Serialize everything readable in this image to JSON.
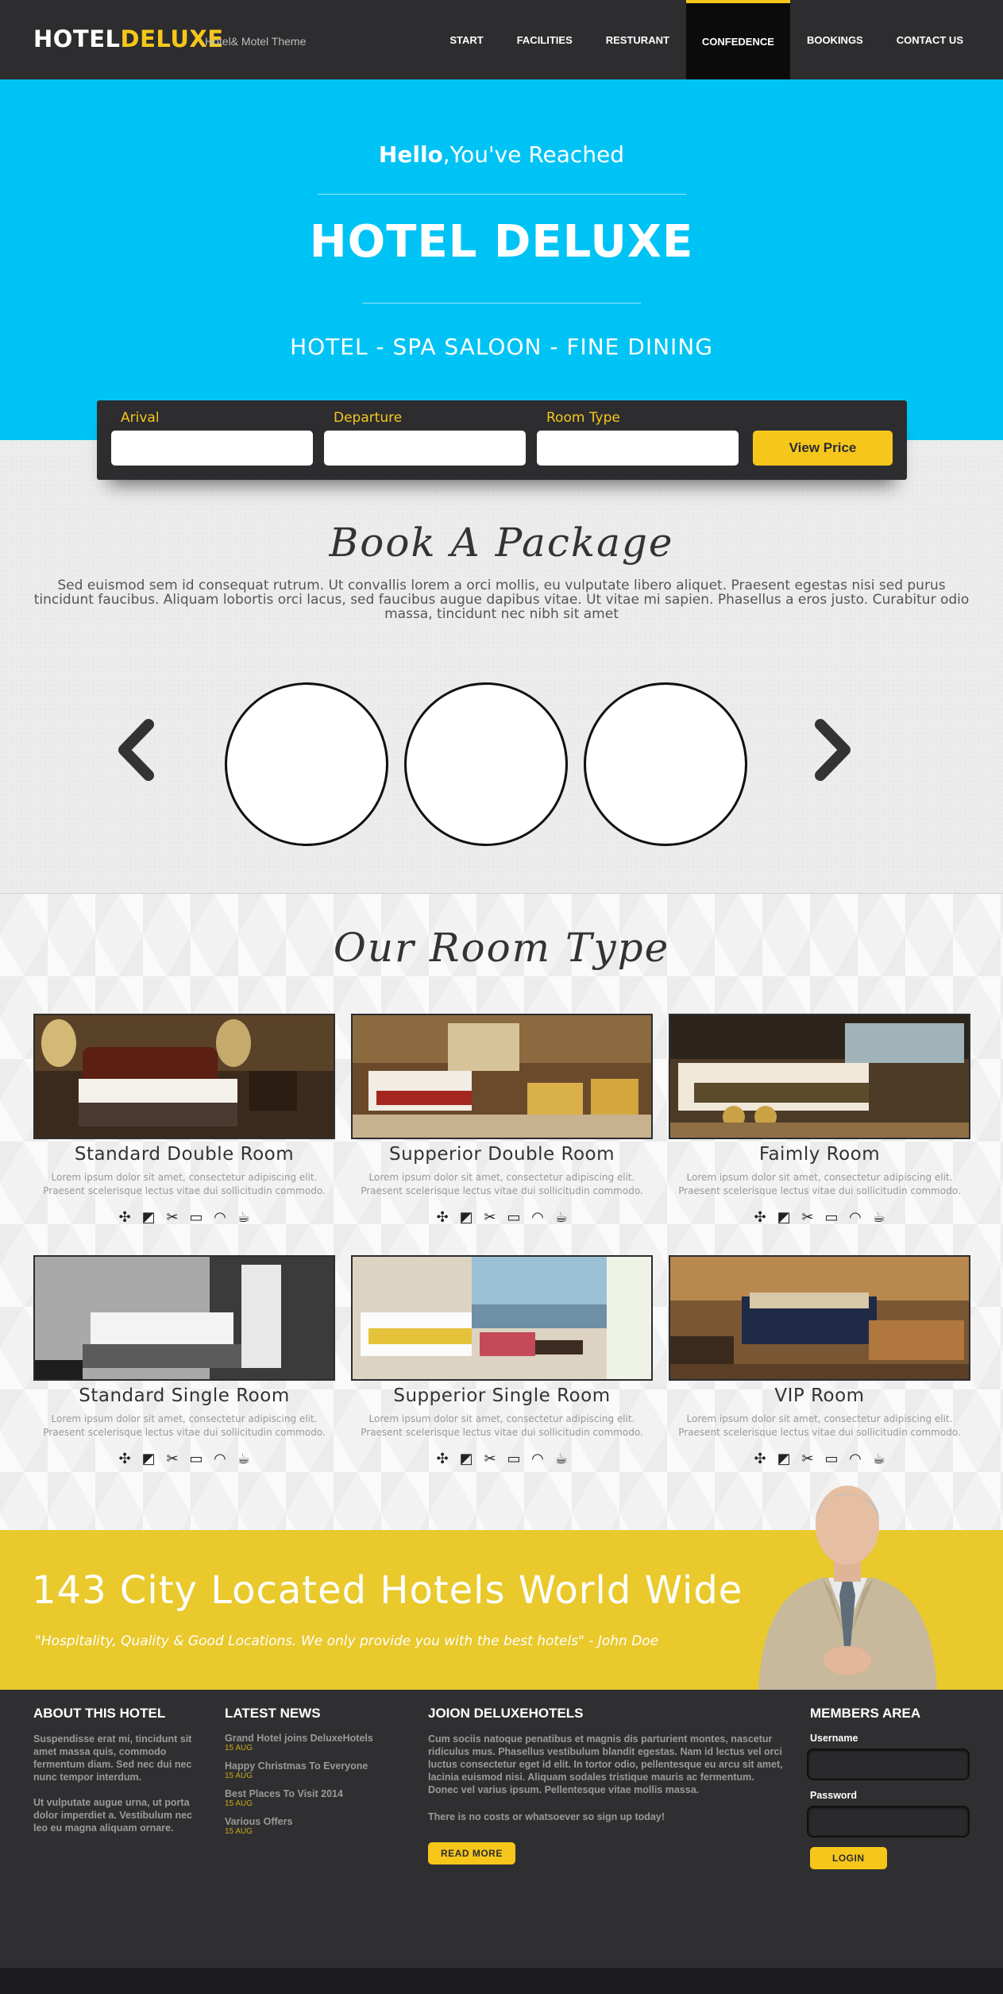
{
  "header": {
    "logo_part1": "HOTEL",
    "logo_part2": "DELUXE",
    "tagline": "Hotel& Motel Theme",
    "nav": [
      "START",
      "FACILITIES",
      "RESTURANT",
      "CONFEDENCE",
      "BOOKINGS",
      "CONTACT US"
    ],
    "active_nav": "CONFEDENCE"
  },
  "hero": {
    "hello_bold": "Hello",
    "hello_rest": ",You've Reached",
    "title": "HOTEL DELUXE",
    "subtitle": "HOTEL - SPA SALOON - FINE DINING"
  },
  "booking": {
    "arrival_label": "Arival",
    "departure_label": "Departure",
    "room_type_label": "Room Type",
    "view_price_label": "View Price"
  },
  "package": {
    "title": "Book A Package",
    "text": "Sed euismod sem id consequat rutrum. Ut convallis lorem a orci mollis, eu vulputate libero aliquet. Praesent egestas nisi sed purus tincidunt faucibus. Aliquam lobortis orci lacus, sed faucibus augue dapibus vitae. Ut vitae mi sapien. Phasellus a eros justo. Curabitur odio massa, tincidunt nec nibh sit amet"
  },
  "rooms": {
    "title": "Our Room Type",
    "desc": "Lorem ipsum dolor sit amet, consectetur adipiscing elit. Praesent scelerisque lectus vitae dui sollicitudin commodo.",
    "items": [
      {
        "name": "Standard Double Room"
      },
      {
        "name": "Supperior Double Room"
      },
      {
        "name": "Faimly Room"
      },
      {
        "name": "Standard Single Room"
      },
      {
        "name": "Supperior Single Room"
      },
      {
        "name": "VIP Room"
      }
    ],
    "amenity_icons": [
      "fan-icon",
      "hair-dryer-icon",
      "iron-icon",
      "tv-icon",
      "wifi-icon",
      "coffee-icon"
    ]
  },
  "banner": {
    "title": "143 City Located Hotels World Wide",
    "quote": "\"Hospitality, Quality & Good Locations. We only provide you with the best hotels\" - John Doe"
  },
  "footer": {
    "about": {
      "heading": "ABOUT THIS HOTEL",
      "p1": "Suspendisse erat mi, tincidunt sit amet massa quis, commodo fermentum diam. Sed nec dui nec nunc tempor interdum.",
      "p2": "Ut vulputate augue urna, ut porta dolor imperdiet a. Vestibulum nec leo eu magna aliquam ornare."
    },
    "news": {
      "heading": "LATEST NEWS",
      "items": [
        {
          "title": "Grand Hotel joins DeluxeHotels",
          "date": "15 AUG"
        },
        {
          "title": "Happy Christmas To Everyone",
          "date": "15 AUG"
        },
        {
          "title": "Best Places To Visit 2014",
          "date": "15 AUG"
        },
        {
          "title": "Various Offers",
          "date": "15 AUG"
        }
      ]
    },
    "join": {
      "heading": "JOION DELUXEHOTELS",
      "text": "Cum sociis natoque penatibus et magnis dis parturient montes, nascetur ridiculus mus. Phasellus vestibulum blandit egestas. Nam id lectus vel orci luctus consectetur eget id elit. In tortor odio, pellentesque eu arcu sit amet, lacinia euismod nisi. Aliquam sodales tristique mauris ac fermentum. Donec vel varius ipsum. Pellentesque vitae mollis massa.",
      "note": "There is no costs or whatsoever so sign up today!",
      "button": "READ MORE"
    },
    "members": {
      "heading": "MEMBERS AREA",
      "username_label": "Username",
      "password_label": "Password",
      "button": "LOGIN"
    }
  },
  "colors": {
    "accent": "#f6c71a",
    "hero_bg": "#00c3f5",
    "dark": "#2d2d30",
    "banner_bg": "#e9c92c"
  }
}
